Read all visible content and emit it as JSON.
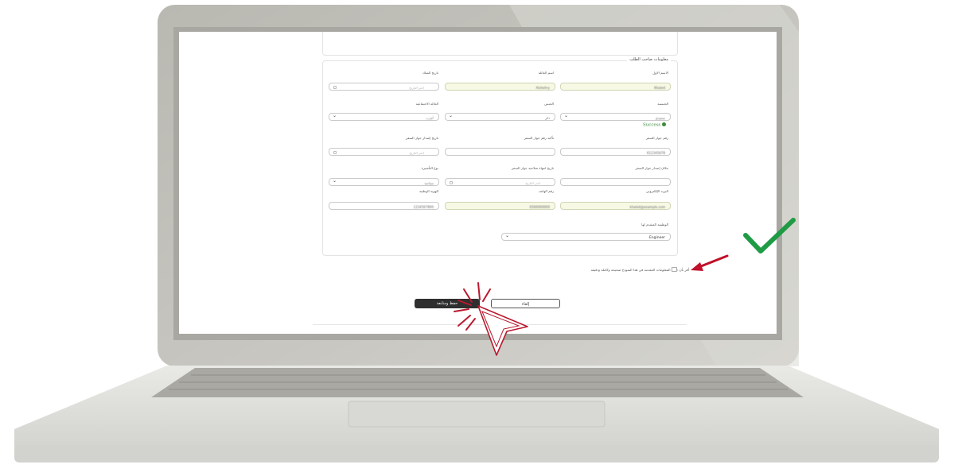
{
  "colors": {
    "laptop_bezel": "#c4c3bd",
    "laptop_base": "#dededa",
    "highlight_field": "#f7f9e4",
    "success_green": "#3a8a3a",
    "primary_button": "#2f2f2f",
    "annotation_red": "#c0102a",
    "check_green": "#1f9b45"
  },
  "icons": {
    "checkmark": "check-icon",
    "arrow": "arrow-left-icon",
    "cursor": "mouse-pointer-icon",
    "calendar": "calendar-icon",
    "dropdown": "chevron-down-icon",
    "success": "check-circle-icon"
  },
  "form": {
    "section_title": "معلومات صاحب الطلب",
    "fields": {
      "first_name": {
        "label": "الاسم الاول",
        "value": "Khaled"
      },
      "family_name": {
        "label": "اسم العائلة",
        "value": "Alshehry"
      },
      "birth_date": {
        "label": "تاريخ الميلاد",
        "placeholder": "اختر التاريخ"
      },
      "nationality": {
        "label": "الجنسية",
        "value": "سعودي",
        "status": "Success"
      },
      "gender": {
        "label": "الجنس",
        "value": "ذكر"
      },
      "marital_status": {
        "label": "الحالة الاجتماعية",
        "value": "أعزب"
      },
      "passport_number": {
        "label": "رقم جواز السفر",
        "value": "K12345678"
      },
      "passport_number_confirm": {
        "label": "تأكيد رقم جواز السفر",
        "value": ""
      },
      "passport_issue_date": {
        "label": "تاريخ إصدار جواز السفر",
        "placeholder": "اختر التاريخ"
      },
      "passport_issue_place": {
        "label": "مكان إصدار جواز السفر",
        "value": ""
      },
      "passport_expiry_date": {
        "label": "تاريخ انتهاء صلاحية جواز السفر",
        "placeholder": "اختر التاريخ"
      },
      "visa_type": {
        "label": "نوع التأشيرة",
        "value": "سياحية"
      },
      "email": {
        "label": "البريد الإلكتروني",
        "value": "khaled@example.com"
      },
      "phone": {
        "label": "رقم الهاتف",
        "value": "0500000000"
      },
      "national_id": {
        "label": "الهوية الوطنية",
        "value": "1234567890"
      },
      "occupation": {
        "label": "الوظيفة المتقدم لها",
        "value": "Engineer"
      }
    },
    "agreement_text": "أقر بأن جميع المعلومات المقدمة في هذا النموذج صحيحة وكاملة ودقيقة",
    "submit_label": "حفظ ومتابعة",
    "cancel_label": "إلغاء"
  }
}
